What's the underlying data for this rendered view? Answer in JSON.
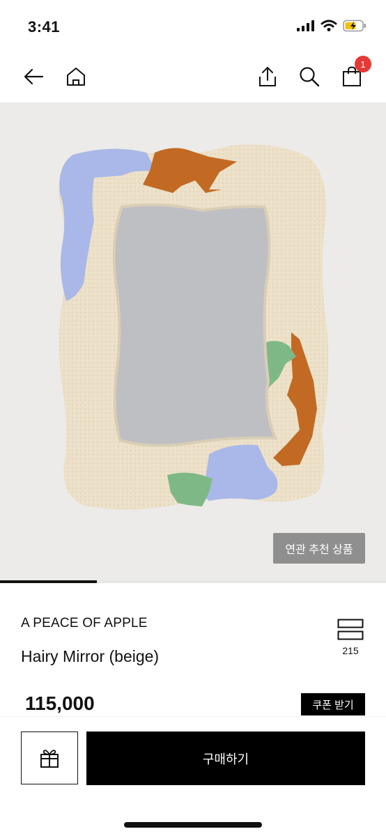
{
  "status_bar": {
    "time": "3:41"
  },
  "nav": {
    "cart_count": "1",
    "icons": [
      "back-arrow-icon",
      "home-icon",
      "share-icon",
      "search-icon",
      "shopping-bag-icon"
    ]
  },
  "hero": {
    "related_button_label": "연관 추천 상품",
    "image_progress": 0.25
  },
  "product": {
    "brand": "A PEACE OF APPLE",
    "name": "Hairy Mirror (beige)",
    "view_count": "215",
    "price": "115,000",
    "coupon_label": "쿠폰 받기"
  },
  "bottom_bar": {
    "buy_label": "구매하기"
  },
  "colors": {
    "accent": "#000000",
    "badge": "#e53935",
    "related_button": "#8f8f8f",
    "hero_background": "#ecebe9"
  }
}
